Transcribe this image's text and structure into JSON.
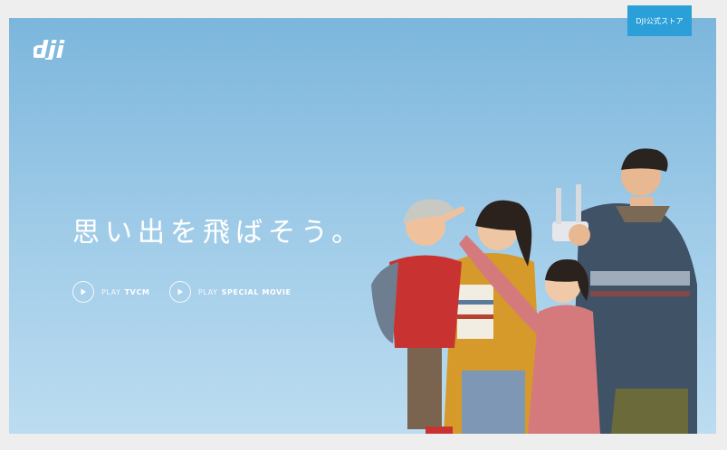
{
  "header": {
    "logo_text": "dji",
    "store_button": "DJI公式ストア"
  },
  "hero": {
    "headline": "思い出を飛ばそう。",
    "play_buttons": [
      {
        "prefix": "PLAY",
        "label": "TVCM"
      },
      {
        "prefix": "PLAY",
        "label": "SPECIAL MOVIE"
      }
    ]
  },
  "colors": {
    "sky_top": "#7cb6dc",
    "sky_bottom": "#bcdcf0",
    "store_button_bg": "#2a9fd8",
    "text": "#ffffff"
  },
  "icons": [
    "play-icon"
  ]
}
